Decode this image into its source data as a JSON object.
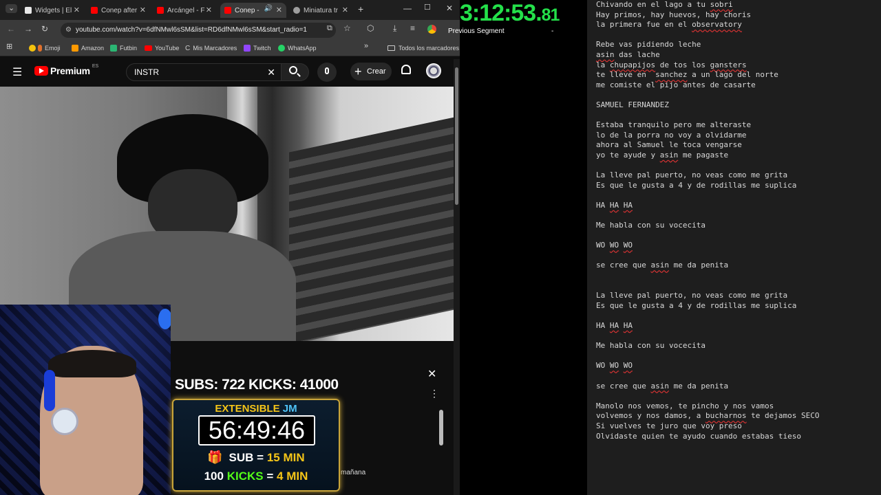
{
  "browser": {
    "tabs": [
      {
        "label": "Widgets | El",
        "color": "#e8e8e8"
      },
      {
        "label": "Conep after",
        "color": "#ff0000"
      },
      {
        "label": "Arcángel - F",
        "color": "#ff0000"
      },
      {
        "label": "Conep -",
        "color": "#ff0000"
      },
      {
        "label": "Miniatura tr",
        "color": "#9e9e9e"
      }
    ],
    "url": "youtube.com/watch?v=6dfNMwl6sSM&list=RD6dfNMwl6sSM&start_radio=1",
    "bookmarks": [
      "Emoji",
      "Amazon",
      "Futbin",
      "YouTube",
      "Mis Marcadores",
      "Twitch",
      "WhatsApp"
    ],
    "all_bookmarks": "Todos los marcadores"
  },
  "youtube": {
    "logo_text": "Premium",
    "logo_badge": "ES",
    "search_value": "INSTR",
    "create_label": "Crear"
  },
  "overlay": {
    "subs_kicks": "SUBS: 722 KICKS: 41000",
    "extensible_a": "EXTENSIBLE",
    "extensible_b": "JM",
    "timer": "56:49:46",
    "sub_a": "SUB",
    "sub_eq": "=",
    "sub_b": "15",
    "sub_unit": "MIN",
    "kicks_a": "100",
    "kicks_b": "KICKS",
    "kicks_eq": "=",
    "kicks_c": "4",
    "kicks_unit": "MIN",
    "manana": "mañana"
  },
  "splits": {
    "time_main": "3:12:53.",
    "time_ms": "81",
    "prev_segment": "Previous Segment",
    "prev_value": "-"
  },
  "lyrics": [
    [
      [
        "Chivando en el lago a tu ",
        0
      ],
      [
        "sobri",
        1
      ]
    ],
    [
      [
        "Hay primos, hay huevos, hay choris",
        0
      ]
    ],
    [
      [
        "la primera fue en el ",
        0
      ],
      [
        "observatory",
        1
      ]
    ],
    [
      [
        "",
        0
      ]
    ],
    [
      [
        "Rebe vas pidiendo leche",
        0
      ]
    ],
    [
      [
        "asin",
        1
      ],
      [
        " das lache",
        0
      ]
    ],
    [
      [
        "la ",
        0
      ],
      [
        "chupapijos",
        1
      ],
      [
        " de tos los ",
        0
      ],
      [
        "gansters",
        1
      ]
    ],
    [
      [
        "te lleve en  ",
        0
      ],
      [
        "sanchez",
        1
      ],
      [
        " a un lago del norte",
        0
      ]
    ],
    [
      [
        "me comiste el pijo antes de casarte",
        0
      ]
    ],
    [
      [
        "",
        0
      ]
    ],
    [
      [
        "SAMUEL FERNANDEZ",
        0
      ]
    ],
    [
      [
        "",
        0
      ]
    ],
    [
      [
        "Estaba tranquilo pero me alteraste",
        0
      ]
    ],
    [
      [
        "lo de la porra no voy a olvidarme",
        0
      ]
    ],
    [
      [
        "ahora al Samuel le toca vengarse",
        0
      ]
    ],
    [
      [
        "yo te ayude y ",
        0
      ],
      [
        "asin",
        1
      ],
      [
        " me pagaste",
        0
      ]
    ],
    [
      [
        "",
        0
      ]
    ],
    [
      [
        "La lleve pal puerto, no veas como me grita",
        0
      ]
    ],
    [
      [
        "Es que le gusta a 4 y de rodillas me suplica",
        0
      ]
    ],
    [
      [
        "",
        0
      ]
    ],
    [
      [
        "HA ",
        0
      ],
      [
        "HA",
        1
      ],
      [
        " ",
        0
      ],
      [
        "HA",
        1
      ]
    ],
    [
      [
        "",
        0
      ]
    ],
    [
      [
        "Me habla con su vocecita",
        0
      ]
    ],
    [
      [
        "",
        0
      ]
    ],
    [
      [
        "WO ",
        0
      ],
      [
        "WO",
        1
      ],
      [
        " ",
        0
      ],
      [
        "WO",
        1
      ]
    ],
    [
      [
        "",
        0
      ]
    ],
    [
      [
        "se cree que ",
        0
      ],
      [
        "asin",
        1
      ],
      [
        " me da penita",
        0
      ]
    ],
    [
      [
        "",
        0
      ]
    ],
    [
      [
        "",
        0
      ]
    ],
    [
      [
        "La lleve pal puerto, no veas como me grita",
        0
      ]
    ],
    [
      [
        "Es que le gusta a 4 y de rodillas me suplica",
        0
      ]
    ],
    [
      [
        "",
        0
      ]
    ],
    [
      [
        "HA ",
        0
      ],
      [
        "HA",
        1
      ],
      [
        " ",
        0
      ],
      [
        "HA",
        1
      ]
    ],
    [
      [
        "",
        0
      ]
    ],
    [
      [
        "Me habla con su vocecita",
        0
      ]
    ],
    [
      [
        "",
        0
      ]
    ],
    [
      [
        "WO ",
        0
      ],
      [
        "WO",
        1
      ],
      [
        " ",
        0
      ],
      [
        "WO",
        1
      ]
    ],
    [
      [
        "",
        0
      ]
    ],
    [
      [
        "se cree que ",
        0
      ],
      [
        "asin",
        1
      ],
      [
        " me da penita",
        0
      ]
    ],
    [
      [
        "",
        0
      ]
    ],
    [
      [
        "Manolo nos vemos, te pincho y nos vamos",
        0
      ]
    ],
    [
      [
        "volvemos y nos damos, a ",
        0
      ],
      [
        "bucharnos",
        1
      ],
      [
        " te dejamos SECO",
        0
      ]
    ],
    [
      [
        "Si vuelves te juro que voy preso",
        0
      ]
    ],
    [
      [
        "Olvidaste quien te ayudo cuando estabas tieso",
        0
      ]
    ]
  ]
}
